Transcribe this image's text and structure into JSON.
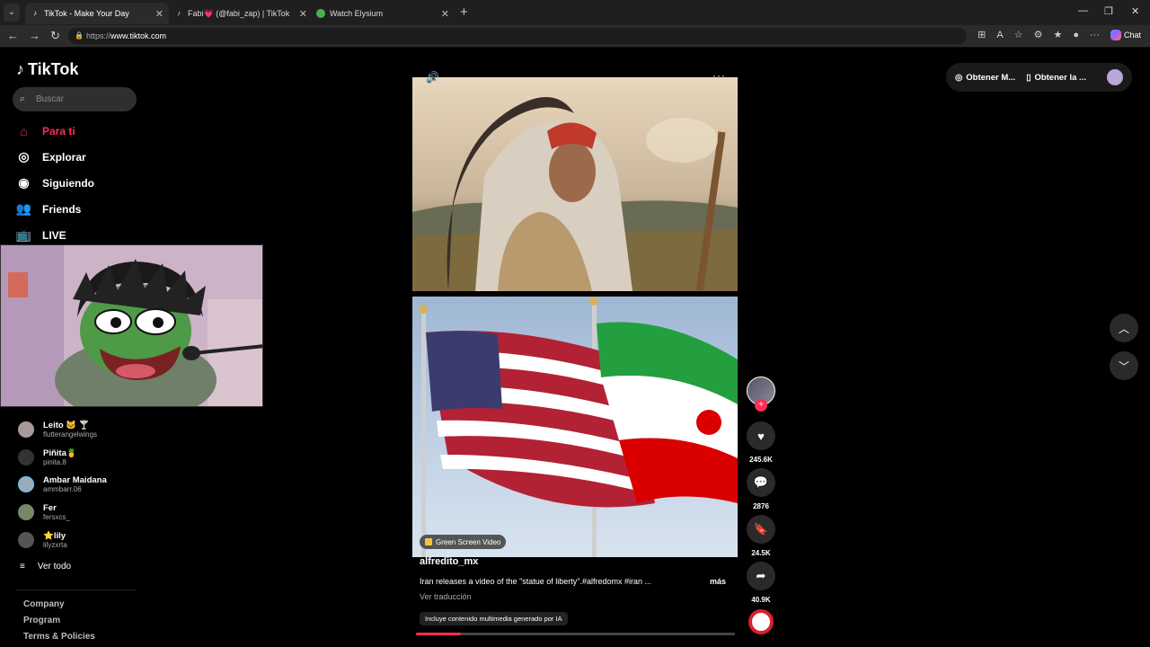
{
  "browser": {
    "tabs": [
      {
        "title": "TikTok - Make Your Day",
        "active": true
      },
      {
        "title": "Fabi💗 (@fabi_zap) | TikTok",
        "active": false
      },
      {
        "title": "Watch Elysium",
        "active": false
      }
    ],
    "url_prefix": "https://",
    "url_host": "www.tiktok.com",
    "chat_label": "Chat"
  },
  "sidebar": {
    "logo": "TikTok",
    "search_placeholder": "Buscar",
    "menu": [
      {
        "label": "Para ti",
        "active": true
      },
      {
        "label": "Explorar"
      },
      {
        "label": "Siguiendo"
      },
      {
        "label": "Friends"
      },
      {
        "label": "LIVE"
      }
    ],
    "following": [
      {
        "name": "Leito 🐱 🍸",
        "user": "flutterangelwings"
      },
      {
        "name": "Piñita🍍",
        "user": "pinita.8"
      },
      {
        "name": "Ambar Maidana",
        "user": "ammbarr.06"
      },
      {
        "name": "Fer",
        "user": "fersxcs_"
      },
      {
        "name": "⭐lily",
        "user": "lilyzxrta"
      }
    ],
    "see_all": "Ver todo",
    "footer": [
      "Company",
      "Program",
      "Terms & Policies"
    ]
  },
  "video": {
    "badge": "Green Screen Video",
    "author": "alfredito_mx",
    "description": "Iran releases a video of the \"statue of liberty\".#alfredomx #iran ...",
    "more": "más",
    "translate": "Ver traducción",
    "ai_label": "Incluye contenido multimedia generado por IA",
    "progress": 0.14
  },
  "actions": {
    "likes": "245.6K",
    "comments": "2876",
    "saves": "24.5K",
    "shares": "40.9K"
  },
  "topright": {
    "item1": "Obtener M...",
    "item2": "Obtener la ..."
  },
  "colors": {
    "accent": "#fe2c55"
  }
}
